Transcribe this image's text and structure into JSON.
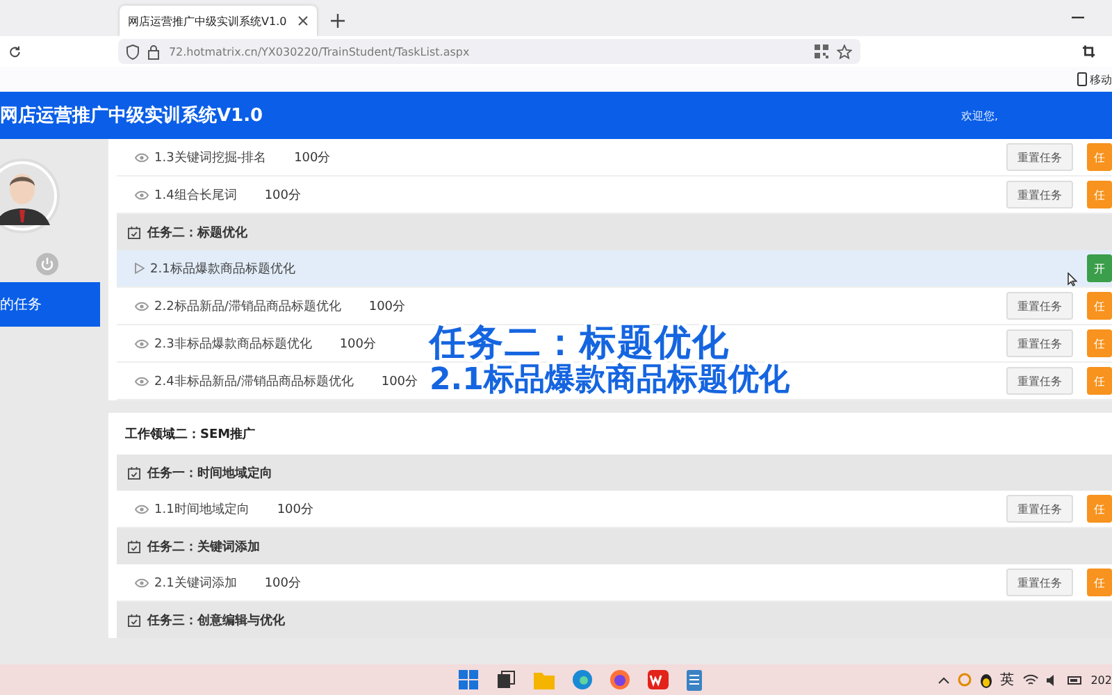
{
  "browser": {
    "tabs": [
      {
        "title": "网店运营推广中级实训系统V1.0",
        "selected": true
      }
    ],
    "url": "72.hotmatrix.cn/YX030220/TrainStudent/TaskList.aspx",
    "bookmark": "移动"
  },
  "header": {
    "title": "网店运营推广中级实训系统V1.0",
    "welcome": "欢迎您,"
  },
  "sidebar": {
    "menu": [
      {
        "label": "的任务",
        "selected": true
      }
    ]
  },
  "sections": [
    {
      "groups": [
        {
          "tasks": [
            {
              "name": "1.3关键词挖掘-排名",
              "score": "100分",
              "kind": "view",
              "selected": false,
              "actions": [
                {
                  "label": "重置任务",
                  "kind": "reset"
                },
                {
                  "label": "任",
                  "kind": "task"
                }
              ]
            },
            {
              "name": "1.4组合长尾词",
              "score": "100分",
              "kind": "view",
              "selected": false,
              "actions": [
                {
                  "label": "重置任务",
                  "kind": "reset"
                },
                {
                  "label": "任",
                  "kind": "task"
                }
              ]
            }
          ]
        },
        {
          "title": "任务二：标题优化",
          "tasks": [
            {
              "name": "2.1标品爆款商品标题优化",
              "kind": "play",
              "selected": true,
              "actions": [
                {
                  "label": "开",
                  "kind": "start"
                }
              ]
            },
            {
              "name": "2.2标品新品/滞销品商品标题优化",
              "score": "100分",
              "kind": "view",
              "selected": false,
              "actions": [
                {
                  "label": "重置任务",
                  "kind": "reset"
                },
                {
                  "label": "任",
                  "kind": "task"
                }
              ]
            },
            {
              "name": "2.3非标品爆款商品标题优化",
              "score": "100分",
              "kind": "view",
              "selected": false,
              "actions": [
                {
                  "label": "重置任务",
                  "kind": "reset"
                },
                {
                  "label": "任",
                  "kind": "task"
                }
              ]
            },
            {
              "name": "2.4非标品新品/滞销品商品标题优化",
              "score": "100分",
              "kind": "view",
              "selected": false,
              "actions": [
                {
                  "label": "重置任务",
                  "kind": "reset"
                },
                {
                  "label": "任",
                  "kind": "task"
                }
              ]
            }
          ]
        }
      ]
    },
    {
      "title": "工作领域二：SEM推广",
      "groups": [
        {
          "title": "任务一：时间地域定向",
          "tasks": [
            {
              "name": "1.1时间地域定向",
              "score": "100分",
              "kind": "view",
              "selected": false,
              "actions": [
                {
                  "label": "重置任务",
                  "kind": "reset"
                },
                {
                  "label": "任",
                  "kind": "task"
                }
              ]
            }
          ]
        },
        {
          "title": "任务二：关键词添加",
          "tasks": [
            {
              "name": "2.1关键词添加",
              "score": "100分",
              "kind": "view",
              "selected": false,
              "actions": [
                {
                  "label": "重置任务",
                  "kind": "reset"
                },
                {
                  "label": "任",
                  "kind": "task"
                }
              ]
            }
          ]
        },
        {
          "title": "任务三：创意编辑与优化"
        }
      ]
    }
  ],
  "caption": {
    "line_1": "任务二：标题优化",
    "line_2": "2.1标品爆款商品标题优化"
  },
  "taskbar": {
    "language": "英",
    "clock": "202"
  }
}
